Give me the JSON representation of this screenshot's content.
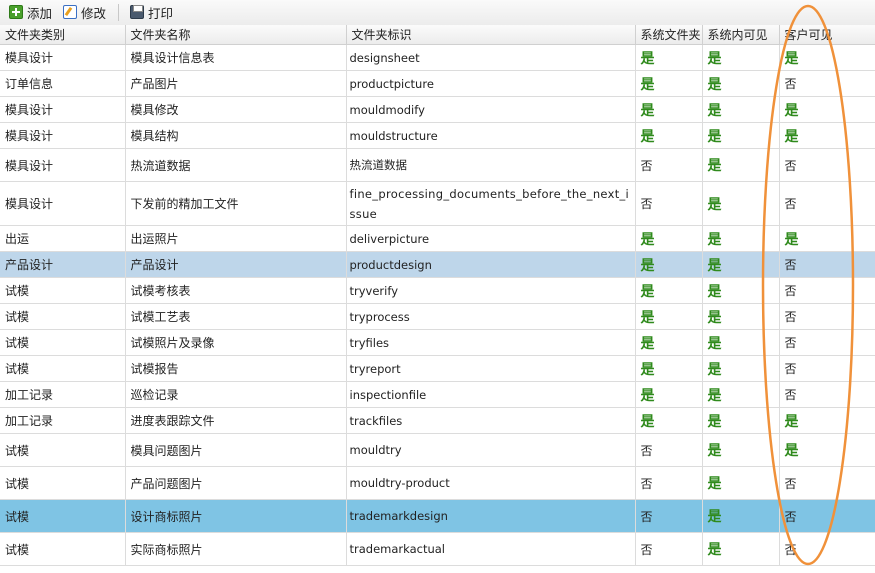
{
  "toolbar": {
    "add_label": "添加",
    "edit_label": "修改",
    "print_label": "打印"
  },
  "columns": [
    "文件夹类别",
    "文件夹名称",
    "文件夹标识",
    "系统文件夹",
    "系统内可见",
    "客户可见"
  ],
  "rows": [
    {
      "category": "模具设计",
      "name": "模具设计信息表",
      "ident": "designsheet",
      "sys": "是",
      "internal": "是",
      "customer": "是"
    },
    {
      "category": "订单信息",
      "name": "产品图片",
      "ident": "productpicture",
      "sys": "是",
      "internal": "是",
      "customer": "否"
    },
    {
      "category": "模具设计",
      "name": "模具修改",
      "ident": "mouldmodify",
      "sys": "是",
      "internal": "是",
      "customer": "是"
    },
    {
      "category": "模具设计",
      "name": "模具结构",
      "ident": "mouldstructure",
      "sys": "是",
      "internal": "是",
      "customer": "是"
    },
    {
      "category": "模具设计",
      "name": "热流道数据",
      "ident": "热流道数据",
      "sys": "否",
      "internal": "是",
      "customer": "否"
    },
    {
      "category": "模具设计",
      "name": "下发前的精加工文件",
      "ident": "fine_processing_documents_before_the_next_issue",
      "sys": "否",
      "internal": "是",
      "customer": "否"
    },
    {
      "category": "出运",
      "name": "出运照片",
      "ident": "deliverpicture",
      "sys": "是",
      "internal": "是",
      "customer": "是"
    },
    {
      "category": "产品设计",
      "name": "产品设计",
      "ident": "productdesign",
      "sys": "是",
      "internal": "是",
      "customer": "否"
    },
    {
      "category": "试模",
      "name": "试模考核表",
      "ident": "tryverify",
      "sys": "是",
      "internal": "是",
      "customer": "否"
    },
    {
      "category": "试模",
      "name": "试模工艺表",
      "ident": "tryprocess",
      "sys": "是",
      "internal": "是",
      "customer": "否"
    },
    {
      "category": "试模",
      "name": "试模照片及录像",
      "ident": "tryfiles",
      "sys": "是",
      "internal": "是",
      "customer": "否"
    },
    {
      "category": "试模",
      "name": "试模报告",
      "ident": "tryreport",
      "sys": "是",
      "internal": "是",
      "customer": "否"
    },
    {
      "category": "加工记录",
      "name": "巡检记录",
      "ident": "inspectionfile",
      "sys": "是",
      "internal": "是",
      "customer": "否"
    },
    {
      "category": "加工记录",
      "name": "进度表跟踪文件",
      "ident": "trackfiles",
      "sys": "是",
      "internal": "是",
      "customer": "是"
    },
    {
      "category": "试模",
      "name": "模具问题图片",
      "ident": "mouldtry",
      "sys": "否",
      "internal": "是",
      "customer": "是"
    },
    {
      "category": "试模",
      "name": "产品问题图片",
      "ident": "mouldtry-product",
      "sys": "否",
      "internal": "是",
      "customer": "否"
    },
    {
      "category": "试模",
      "name": "设计商标照片",
      "ident": "trademarkdesign",
      "sys": "否",
      "internal": "是",
      "customer": "否"
    },
    {
      "category": "试模",
      "name": "实际商标照片",
      "ident": "trademarkactual",
      "sys": "否",
      "internal": "是",
      "customer": "否"
    }
  ],
  "colors": {
    "yes": "#2f8a1c",
    "selected_row": "#bed6ea",
    "current_row": "#7fc4e4",
    "annotation": "#f0913a"
  }
}
